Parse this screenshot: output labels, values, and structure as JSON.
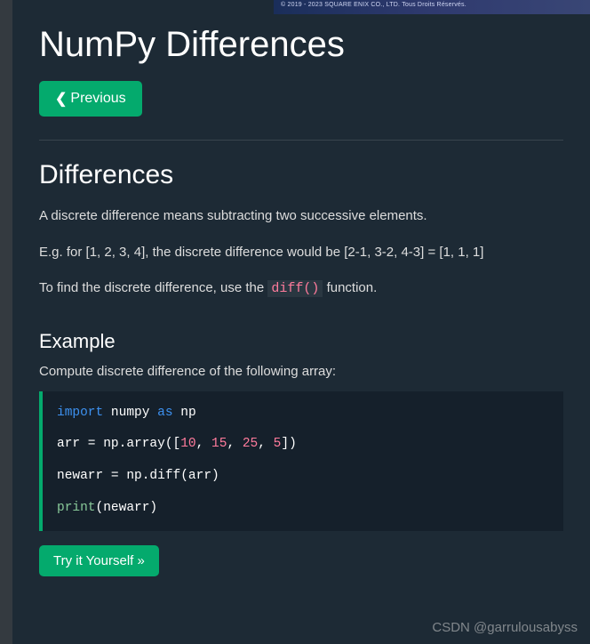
{
  "ad": {
    "text": "© 2019 - 2023 SQUARE ENIX CO., LTD. Tous Droits Réservés."
  },
  "page": {
    "title": "NumPy Differences",
    "prev_label": "Previous"
  },
  "section": {
    "heading": "Differences",
    "p1": "A discrete difference means subtracting two successive elements.",
    "p2": "E.g. for [1, 2, 3, 4], the discrete difference would be [2-1, 3-2, 4-3] = [1, 1, 1]",
    "p3_pre": "To find the discrete difference, use the ",
    "p3_code": "diff()",
    "p3_post": " function."
  },
  "example": {
    "title": "Example",
    "desc": "Compute discrete difference of the following array:",
    "code": {
      "l1_kw1": "import",
      "l1_mid": " numpy ",
      "l1_kw2": "as",
      "l1_end": " np",
      "l2_pre": "arr = np.array([",
      "l2_n1": "10",
      "l2_c1": ", ",
      "l2_n2": "15",
      "l2_c2": ", ",
      "l2_n3": "25",
      "l2_c3": ", ",
      "l2_n4": "5",
      "l2_post": "])",
      "l3": "newarr = np.diff(arr)",
      "l4_kw": "print",
      "l4_rest": "(newarr)"
    },
    "try_label": "Try it Yourself »"
  },
  "watermark": "CSDN @garrulousabyss"
}
